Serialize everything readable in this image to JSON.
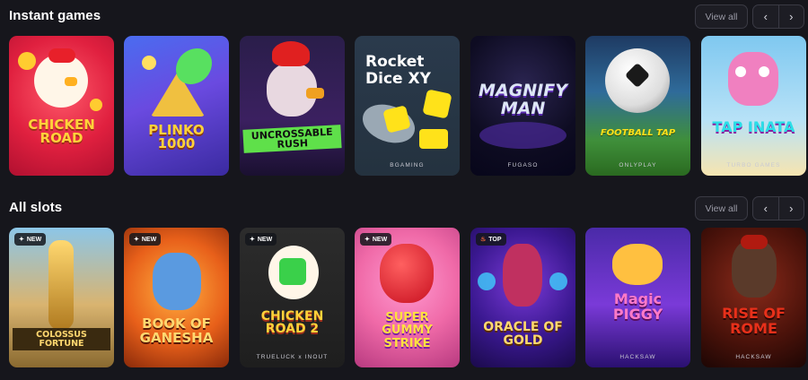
{
  "instant": {
    "title": "Instant games",
    "view_all": "View all",
    "prev": "‹",
    "next": "›",
    "games": [
      {
        "title": "CHICKEN ROAD",
        "provider": ""
      },
      {
        "title": "PLINKO 1000",
        "provider": ""
      },
      {
        "title": "UNCROSSABLE RUSH",
        "provider": ""
      },
      {
        "title": "Rocket Dice XY",
        "provider": "BGAMING"
      },
      {
        "title": "MAGNIFY MAN",
        "provider": "FUGASO"
      },
      {
        "title": "FOOTBALL TAP",
        "provider": "ONLYPLAY"
      },
      {
        "title": "TAP INATA",
        "provider": "TURBO GAMES"
      }
    ]
  },
  "slots": {
    "title": "All slots",
    "view_all": "View all",
    "prev": "‹",
    "next": "›",
    "games": [
      {
        "title": "COLOSSUS FORTUNE",
        "provider": "",
        "badge": "NEW"
      },
      {
        "title": "BOOK OF GANESHA",
        "provider": "",
        "badge": "NEW"
      },
      {
        "title": "CHICKEN ROAD 2",
        "provider": "TRUELUCK x INOUT",
        "badge": "NEW"
      },
      {
        "title": "SUPER GUMMY STRIKE",
        "provider": "",
        "badge": "NEW"
      },
      {
        "title": "ORACLE OF GOLD",
        "provider": "",
        "badge": "TOP"
      },
      {
        "title": "Magic PIGGY",
        "provider": "HACKSAW",
        "badge": ""
      },
      {
        "title": "RISE OF ROME",
        "provider": "HACKSAW",
        "badge": ""
      }
    ]
  },
  "colors": {
    "background": "#16161c",
    "badge_bg": "#14161c",
    "button_border": "#3a3a44"
  },
  "icons": {
    "badge_new": "sparkle-icon",
    "badge_top": "flame-icon",
    "prev": "chevron-left-icon",
    "next": "chevron-right-icon"
  }
}
